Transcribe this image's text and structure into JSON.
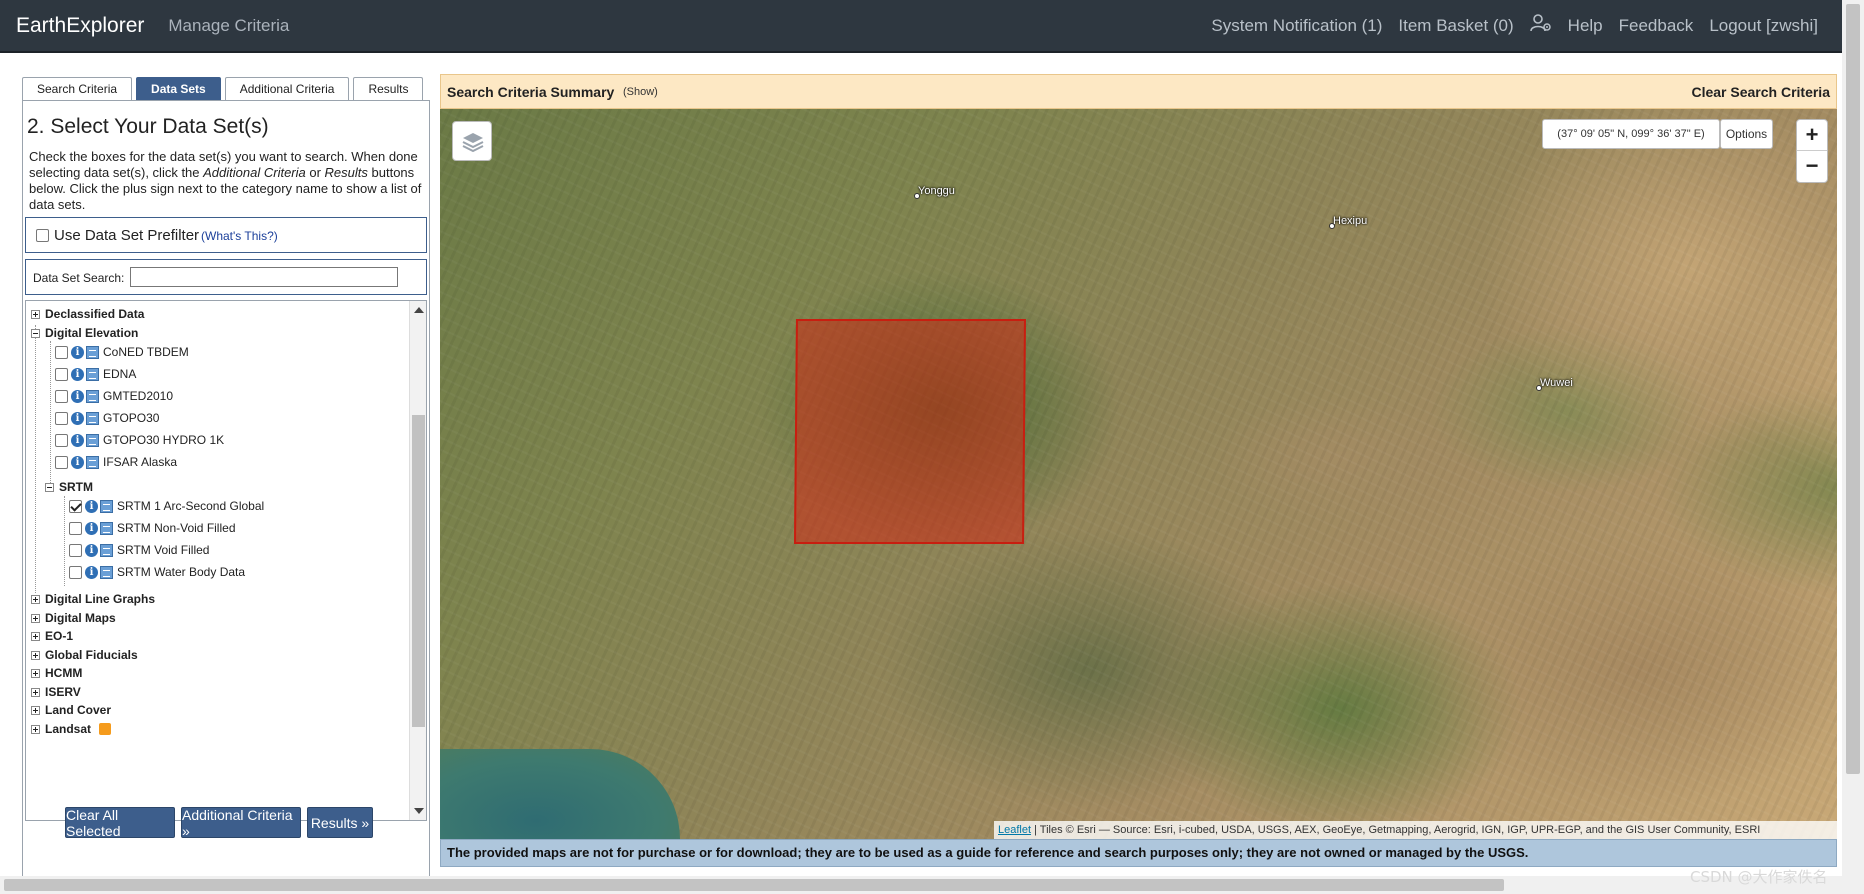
{
  "topnav": {
    "brand": "EarthExplorer",
    "subtitle": "Manage Criteria",
    "links": {
      "notification": "System Notification (1)",
      "basket": "Item Basket (0)",
      "help": "Help",
      "feedback": "Feedback",
      "logout": "Logout [zwshi]"
    }
  },
  "tabs": [
    "Search Criteria",
    "Data Sets",
    "Additional Criteria",
    "Results"
  ],
  "active_tab": "Data Sets",
  "panel": {
    "title": "2. Select Your Data Set(s)",
    "instructions_1": "Check the boxes for the data set(s) you want to search. When done selecting data set(s), click the ",
    "instructions_em1": "Additional Criteria",
    "instructions_2": " or ",
    "instructions_em2": "Results",
    "instructions_3": " buttons below. Click the plus sign next to the category name to show a list of data sets.",
    "prefilter_label": "Use Data Set Prefilter",
    "whats_this": "(What's This?)",
    "search_label": "Data Set Search:",
    "search_value": ""
  },
  "tree": {
    "declassified": "Declassified Data",
    "digital_elevation": "Digital Elevation",
    "elevation_items": [
      "CoNED TBDEM",
      "EDNA",
      "GMTED2010",
      "GTOPO30",
      "GTOPO30 HYDRO 1K",
      "IFSAR Alaska"
    ],
    "srtm": "SRTM",
    "srtm_items": [
      "SRTM 1 Arc-Second Global",
      "SRTM Non-Void Filled",
      "SRTM Void Filled",
      "SRTM Water Body Data"
    ],
    "srtm_checked": "SRTM 1 Arc-Second Global",
    "categories": [
      "Digital Line Graphs",
      "Digital Maps",
      "EO-1",
      "Global Fiducials",
      "HCMM",
      "ISERV",
      "Land Cover",
      "Landsat"
    ]
  },
  "buttons": {
    "clear": "Clear All Selected",
    "additional": "Additional Criteria »",
    "results": "Results »"
  },
  "summary": {
    "title": "Search Criteria Summary",
    "show": "(Show)",
    "clear": "Clear Search Criteria"
  },
  "map": {
    "coordinates": "(37° 09' 05\" N, 099° 36' 37\" E)",
    "options": "Options",
    "zoom_in": "+",
    "zoom_out": "−",
    "cities": [
      "Yonggu",
      "Hexipu",
      "Wuwei"
    ],
    "attribution_link": "Leaflet",
    "attribution_text": " | Tiles © Esri — Source: Esri, i-cubed, USDA, USGS, AEX, GeoEye, Getmapping, Aerogrid, IGN, IGP, UPR-EGP, and the GIS User Community, ESRI",
    "selection_color": "#c81e10"
  },
  "disclaimer": "The provided maps are not for purchase or for download; they are to be used as a guide for reference and search purposes only; they are not owned or managed by the USGS.",
  "watermark": "CSDN @大作家佚名",
  "icons": [
    "user-gear-icon",
    "layers-icon",
    "info-icon",
    "map-overlay-icon",
    "rss-icon"
  ],
  "colors": {
    "nav_bg": "#2e3740",
    "accent": "#3d5e8c",
    "summary_bg": "#fde8c4",
    "disclaimer_bg": "#aec6dc"
  }
}
